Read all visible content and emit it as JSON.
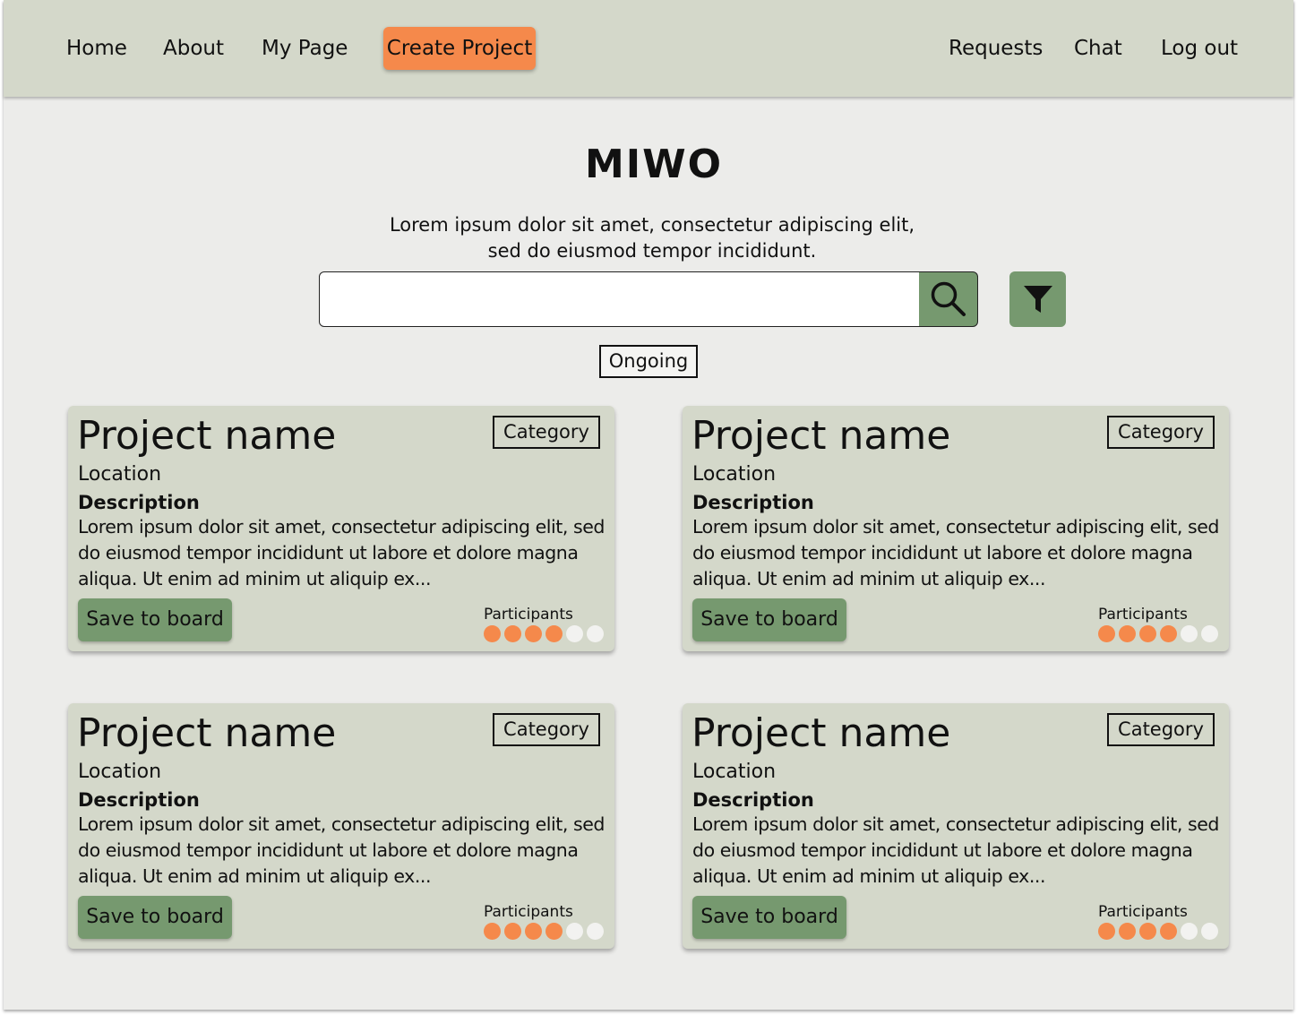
{
  "nav": {
    "left_items": [
      "Home",
      "About",
      "My Page"
    ],
    "cta_label": "Create Project",
    "right_items": [
      "Requests",
      "Chat",
      "Log out"
    ]
  },
  "hero": {
    "title": "MIWO",
    "subtitle_line1": "Lorem ipsum dolor sit amet, consectetur adipiscing elit,",
    "subtitle_line2": "sed do eiusmod tempor incididunt.",
    "search_value": "",
    "status_chip": "Ongoing"
  },
  "icons": {
    "search": "search-icon",
    "filter": "filter-icon"
  },
  "colors": {
    "accent_orange": "#f5894b",
    "accent_green": "#76996f",
    "panel": "#d4d8ca",
    "background": "#ececea"
  },
  "cards": [
    {
      "title": "Project name",
      "category": "Category",
      "location": "Location",
      "description_label": "Description",
      "description": "Lorem ipsum dolor sit amet, consectetur adipiscing elit, sed do eiusmod tempor incididunt ut labore et dolore magna aliqua. Ut enim ad minim ut aliquip ex...",
      "save_label": "Save to board",
      "participants_label": "Participants",
      "participants_filled": 4,
      "participants_total": 6
    },
    {
      "title": "Project name",
      "category": "Category",
      "location": "Location",
      "description_label": "Description",
      "description": "Lorem ipsum dolor sit amet, consectetur adipiscing elit, sed do eiusmod tempor incididunt ut labore et dolore magna aliqua. Ut enim ad minim ut aliquip ex...",
      "save_label": "Save to board",
      "participants_label": "Participants",
      "participants_filled": 4,
      "participants_total": 6
    },
    {
      "title": "Project name",
      "category": "Category",
      "location": "Location",
      "description_label": "Description",
      "description": "Lorem ipsum dolor sit amet, consectetur adipiscing elit, sed do eiusmod tempor incididunt ut labore et dolore magna aliqua. Ut enim ad minim ut aliquip ex...",
      "save_label": "Save to board",
      "participants_label": "Participants",
      "participants_filled": 4,
      "participants_total": 6
    },
    {
      "title": "Project name",
      "category": "Category",
      "location": "Location",
      "description_label": "Description",
      "description": "Lorem ipsum dolor sit amet, consectetur adipiscing elit, sed do eiusmod tempor incididunt ut labore et dolore magna aliqua. Ut enim ad minim ut aliquip ex...",
      "save_label": "Save to board",
      "participants_label": "Participants",
      "participants_filled": 4,
      "participants_total": 6
    }
  ]
}
